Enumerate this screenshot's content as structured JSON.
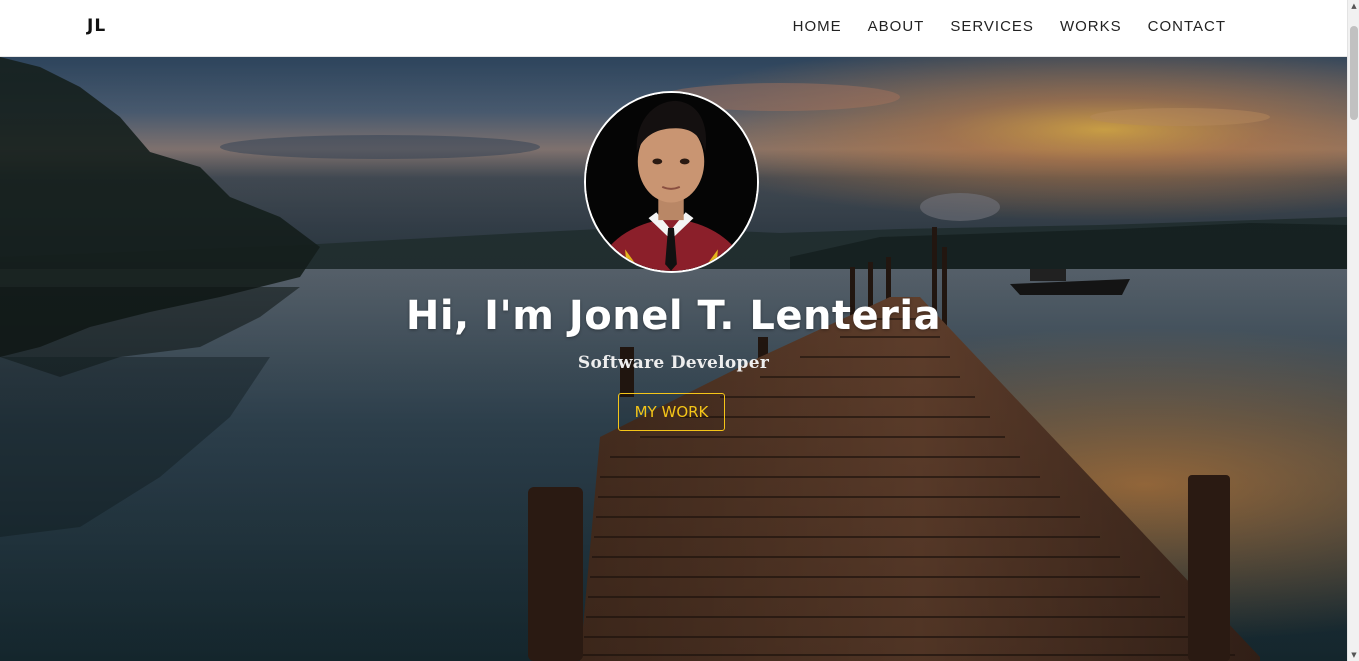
{
  "brand": "JL",
  "nav": {
    "home": "HOME",
    "about": "ABOUT",
    "services": "SERVICES",
    "works": "WORKS",
    "contact": "CONTACT"
  },
  "hero": {
    "title": "Hi, I'm Jonel T. Lenteria",
    "subtitle": "Software Developer",
    "button_label": "MY WORK",
    "background": "sunset-lake-wooden-pier-photo",
    "avatar": "profile-photo"
  },
  "colors": {
    "accent": "#f5c518",
    "navbar_bg": "#ffffff",
    "nav_text": "#222222",
    "hero_text": "#ffffff"
  },
  "icons": {
    "scroll_up": "scroll-up-arrow-icon",
    "scroll_down": "scroll-down-arrow-icon"
  }
}
